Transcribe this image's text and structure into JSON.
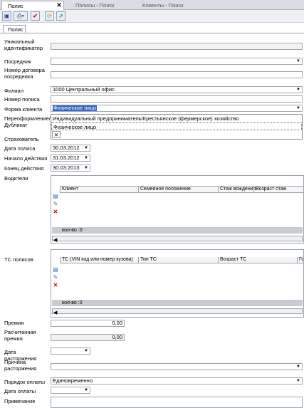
{
  "tabs": [
    {
      "label": "Полис",
      "close": "✕"
    },
    {
      "label": "Полисы - Поиск"
    },
    {
      "label": "Клиенты - Поиск"
    }
  ],
  "toolbar": {
    "icons": [
      "save-icon",
      "print-icon",
      "check-icon",
      "refresh-icon",
      "export-icon"
    ]
  },
  "inner_tab": "Полис",
  "form": {
    "unique_id_label": "Уникальный идентификатор",
    "unique_id_value": "",
    "agent_label": "Посредник",
    "agent_value": "",
    "agent_contract_label": "Номер договора посредника",
    "agent_contract_value": "",
    "branch_label": "Филиал",
    "branch_value": "1000 Центральный офис",
    "policy_no_label": "Номер полиса",
    "policy_no_value": "",
    "client_form_label": "Форма клиента",
    "client_form_value": "Физическое лицо",
    "reissue_label": "Переоформление/Дубликат",
    "insurer_label": "Страхователь",
    "policy_date_label": "Дата полиса",
    "policy_date_value": "30.03.2012",
    "start_label": "Начало действия",
    "start_value": "31.03.2012",
    "end_label": "Конец действия",
    "end_value": "30.03.2013",
    "drivers_label": "Водители",
    "vehicles_label": "ТС полисов",
    "premium_label": "Премия",
    "premium_value": "0,00",
    "calc_premium_label": "Расчитанная премия",
    "calc_premium_value": "0,00",
    "termination_date_label": "Дата расторжения",
    "termination_reason_label": "Причина расторжения",
    "payment_order_label": "Порядок оплаты",
    "payment_order_value": "Единовременно",
    "payment_date_label": "Дата оплаты",
    "note_label": "Примечание"
  },
  "dropdown": {
    "options": [
      "Индивидуальный предприниматель/Крестьянское (фермерское) хозяйство",
      "Физическое лицо"
    ],
    "close": "✕"
  },
  "drivers_grid": {
    "columns": [
      "Клиент",
      "Семейное положение",
      "Стаж вождения",
      "Возраст стаж"
    ],
    "count": "кол-во :0"
  },
  "vehicles_grid": {
    "columns": [
      "ТС (VIN код или номер кузова)",
      "Тип ТС",
      "Возраст ТС",
      "Го"
    ],
    "count": "кол-во :0"
  }
}
